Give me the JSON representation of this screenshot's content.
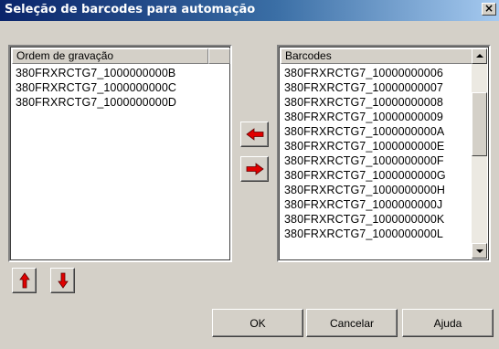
{
  "window": {
    "title": "Seleção de barcodes para automação",
    "close_glyph": "×"
  },
  "left_list": {
    "header": "Ordem de gravação",
    "items": [
      "380FRXRCTG7_1000000000B",
      "380FRXRCTG7_1000000000C",
      "380FRXRCTG7_1000000000D"
    ]
  },
  "right_list": {
    "header": "Barcodes",
    "items": [
      "380FRXRCTG7_10000000006",
      "380FRXRCTG7_10000000007",
      "380FRXRCTG7_10000000008",
      "380FRXRCTG7_10000000009",
      "380FRXRCTG7_1000000000A",
      "380FRXRCTG7_1000000000E",
      "380FRXRCTG7_1000000000F",
      "380FRXRCTG7_1000000000G",
      "380FRXRCTG7_1000000000H",
      "380FRXRCTG7_1000000000J",
      "380FRXRCTG7_1000000000K",
      "380FRXRCTG7_1000000000L"
    ]
  },
  "transfer_buttons": {
    "move_left_icon": "arrow-left-icon",
    "move_right_icon": "arrow-right-icon"
  },
  "order_buttons": {
    "move_up_icon": "arrow-up-icon",
    "move_down_icon": "arrow-down-icon"
  },
  "buttons": {
    "ok": "OK",
    "cancel": "Cancelar",
    "help": "Ajuda"
  },
  "colors": {
    "titlebar_start": "#0a246a",
    "titlebar_end": "#a6caf0",
    "face": "#d4d0c8",
    "arrow_red": "#e00000"
  }
}
